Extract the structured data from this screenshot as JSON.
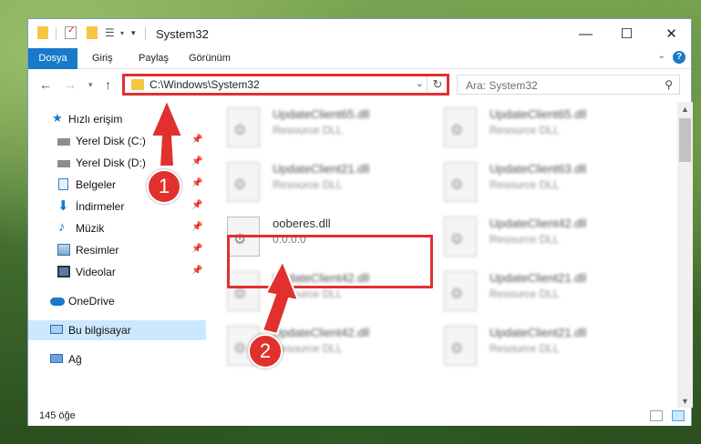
{
  "window": {
    "title": "System32",
    "controls": {
      "minimize": "—",
      "maximize": "☐",
      "close": "✕"
    }
  },
  "ribbon": {
    "tabs": [
      "Dosya",
      "Giriş",
      "Paylaş",
      "Görünüm"
    ],
    "help": "?"
  },
  "navigation": {
    "address": "C:\\Windows\\System32",
    "search_placeholder": "Ara: System32"
  },
  "sidebar": {
    "items": [
      {
        "label": "Hızlı erişim",
        "icon": "star-icon"
      },
      {
        "label": "Yerel Disk (C:)",
        "icon": "drive-icon",
        "pinned": true
      },
      {
        "label": "Yerel Disk (D:)",
        "icon": "drive-icon",
        "pinned": true
      },
      {
        "label": "Belgeler",
        "icon": "documents-icon",
        "pinned": true
      },
      {
        "label": "İndirmeler",
        "icon": "download-icon",
        "pinned": true
      },
      {
        "label": "Müzik",
        "icon": "music-icon",
        "pinned": true
      },
      {
        "label": "Resimler",
        "icon": "pictures-icon",
        "pinned": true
      },
      {
        "label": "Videolar",
        "icon": "videos-icon",
        "pinned": true
      },
      {
        "label": "OneDrive",
        "icon": "cloud-icon"
      },
      {
        "label": "Bu bilgisayar",
        "icon": "computer-icon",
        "selected": true
      },
      {
        "label": "Ağ",
        "icon": "network-icon"
      }
    ]
  },
  "files": [
    {
      "name": "UpdateClient65.dll",
      "sub": "Resource DLL"
    },
    {
      "name": "UpdateClient65.dll",
      "sub": "Resource DLL"
    },
    {
      "name": "UpdateClient21.dll",
      "sub": "Resource DLL"
    },
    {
      "name": "UpdateClient63.dll",
      "sub": "Resource DLL"
    },
    {
      "name": "ooberes.dll",
      "sub": "0.0.0.0"
    },
    {
      "name": "UpdateClient42.dll",
      "sub": "Resource DLL"
    },
    {
      "name": "UpdateClient42.dll",
      "sub": "Resource DLL"
    },
    {
      "name": "UpdateClient21.dll",
      "sub": "Resource DLL"
    },
    {
      "name": "UpdateClient42.dll",
      "sub": "Resource DLL"
    },
    {
      "name": "UpdateClient21.dll",
      "sub": "Resource DLL"
    }
  ],
  "status": {
    "count": "145 öğe"
  },
  "annotations": {
    "step1": "1",
    "step2": "2",
    "color": "#e0312f"
  }
}
